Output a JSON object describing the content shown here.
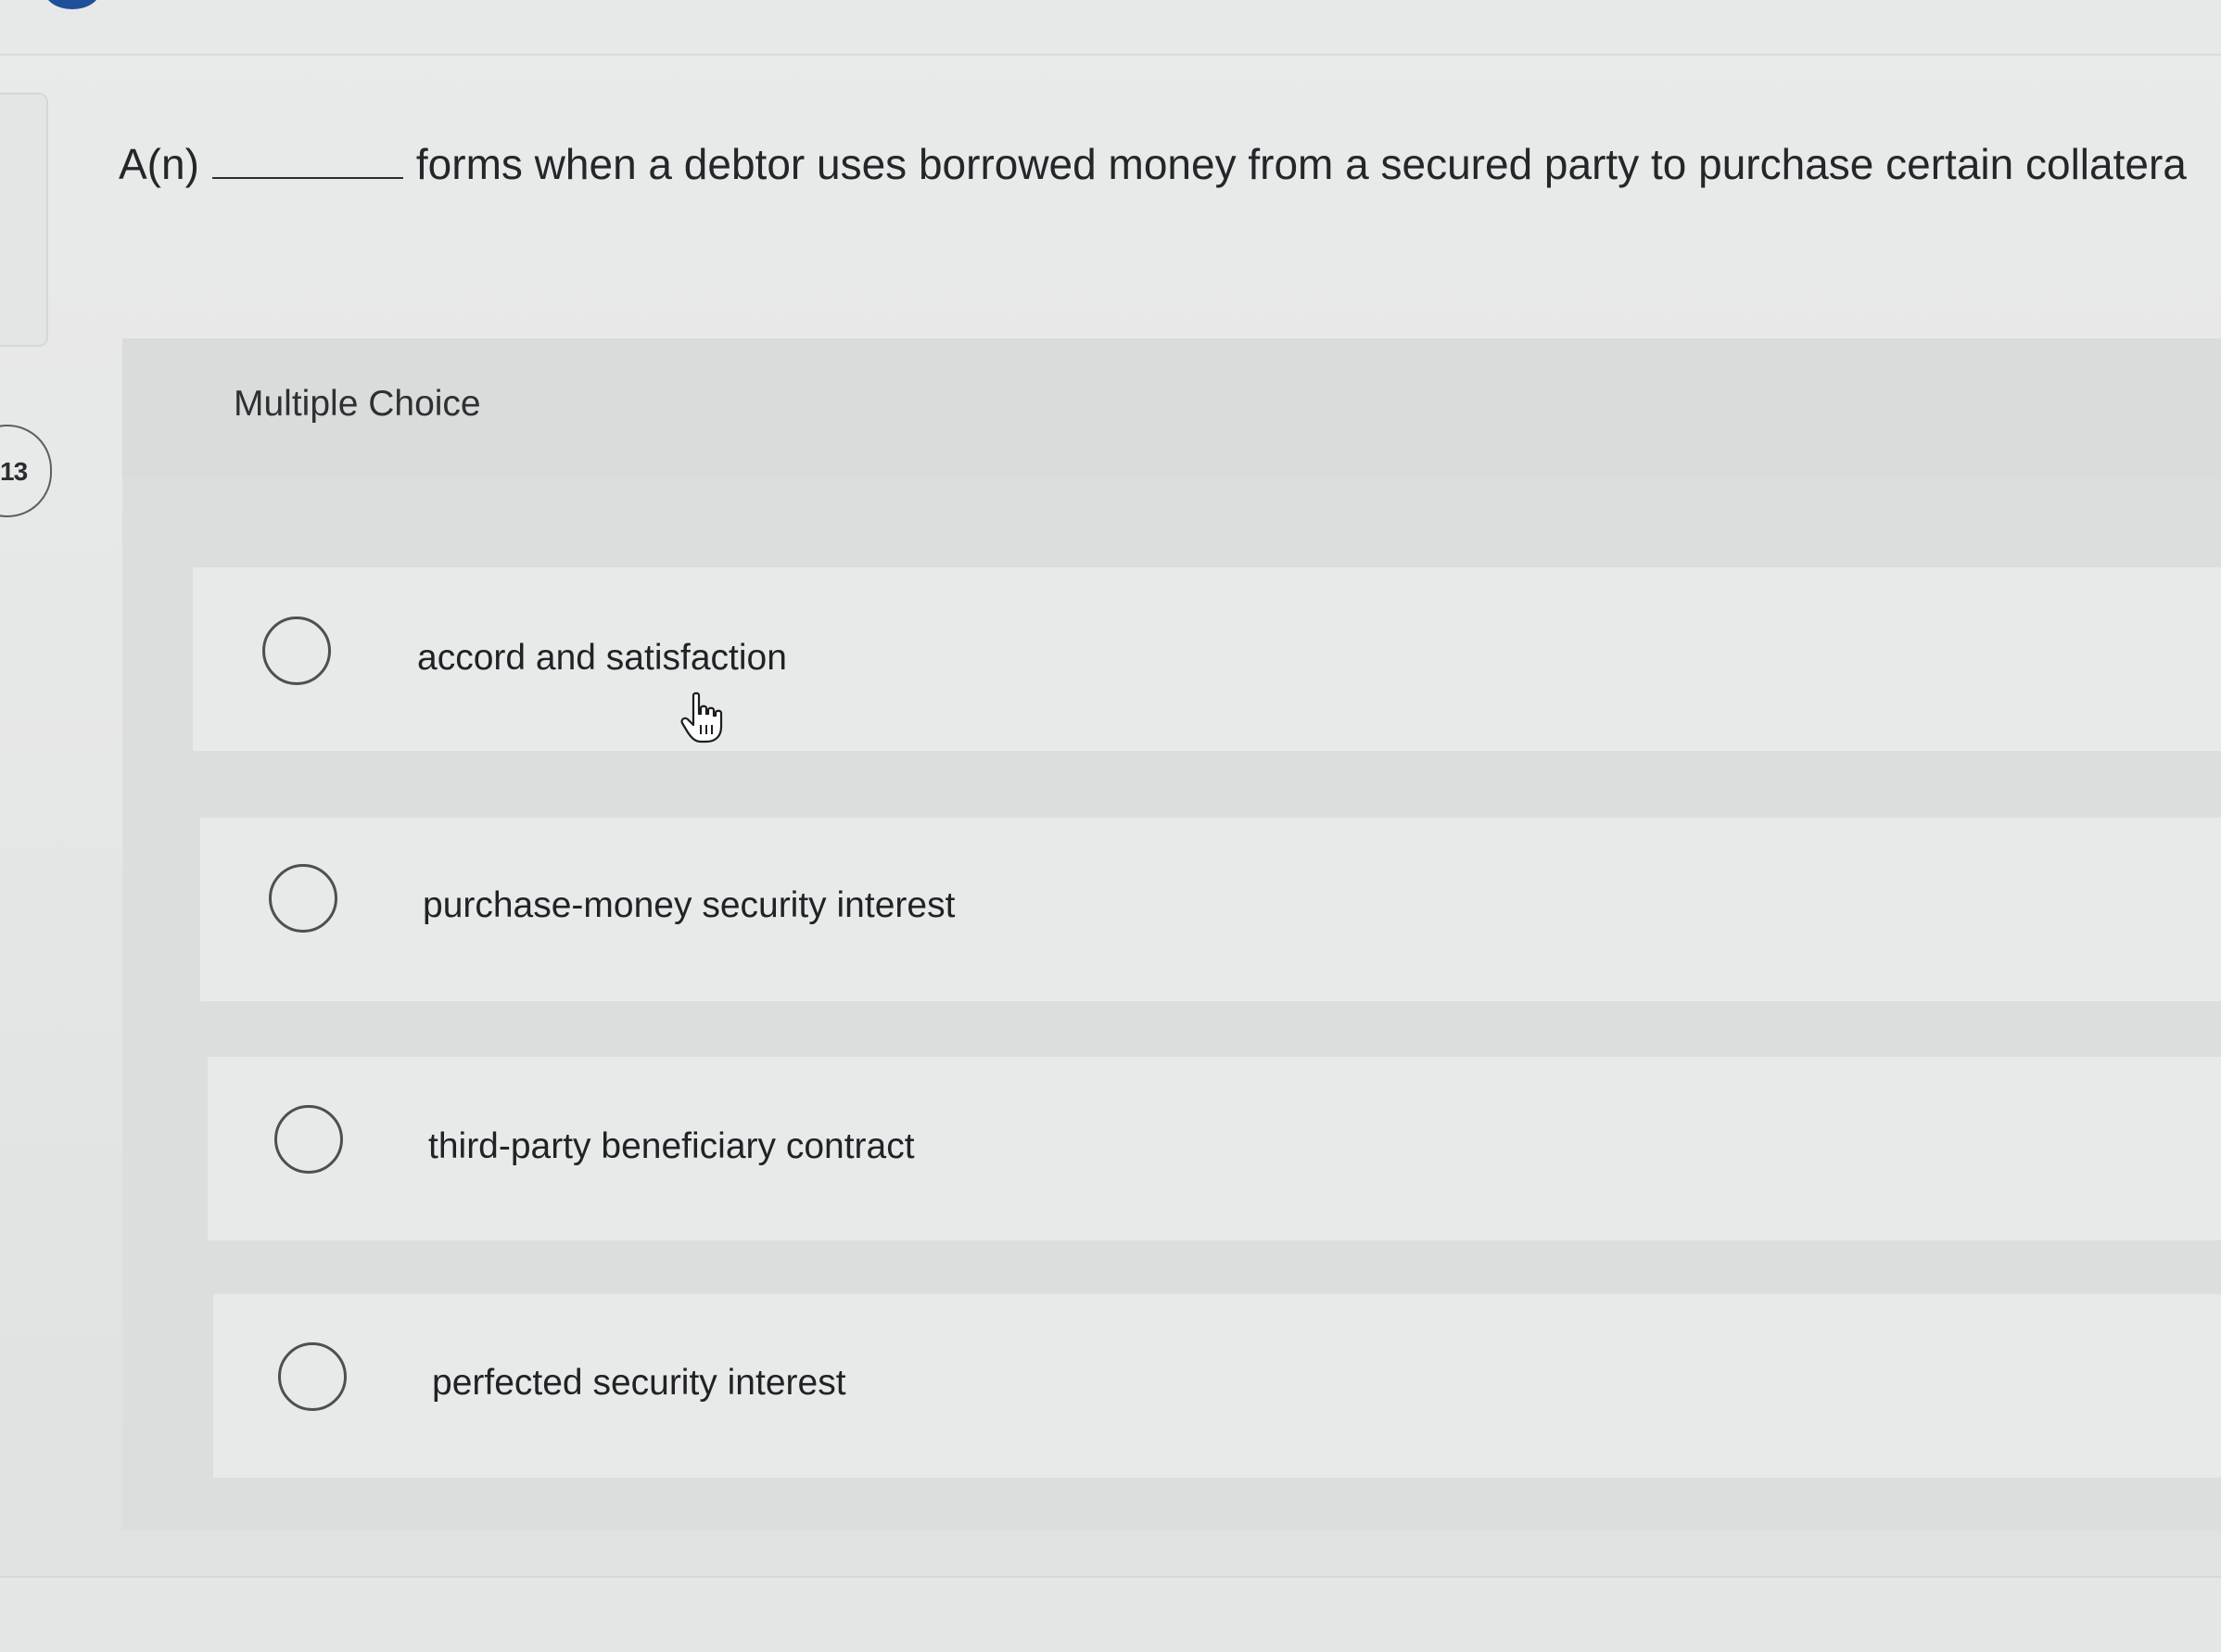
{
  "question": {
    "number": "13",
    "prefix": "A(n)",
    "text": "forms when a debtor uses borrowed money from a secured party to purchase certain collatera"
  },
  "multiple_choice": {
    "header": "Multiple Choice",
    "options": [
      {
        "label": "accord and satisfaction",
        "selected": false
      },
      {
        "label": "purchase-money security interest",
        "selected": false
      },
      {
        "label": "third-party beneficiary contract",
        "selected": false
      },
      {
        "label": "perfected security interest",
        "selected": false
      }
    ]
  },
  "icons": {
    "cursor": "hand-pointer-icon"
  }
}
